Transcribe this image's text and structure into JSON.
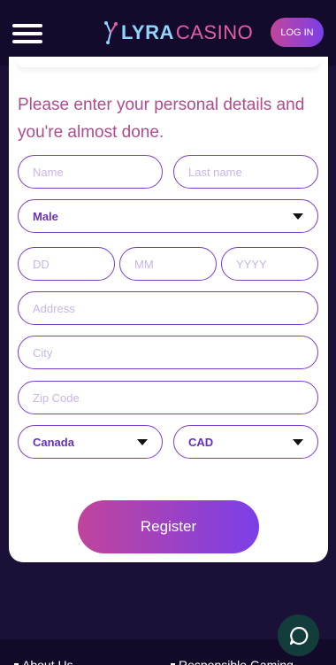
{
  "header": {
    "logo_word_1": "LYRA",
    "logo_word_2": "CASINO",
    "login_label": "LOG IN",
    "menu_icon": "hamburger-icon"
  },
  "form": {
    "heading": "Please enter your personal details and you're almost done.",
    "name_placeholder": "Name",
    "last_name_placeholder": "Last name",
    "gender_value": "Male",
    "dd_placeholder": "DD",
    "mm_placeholder": "MM",
    "yyyy_placeholder": "YYYY",
    "address_placeholder": "Address",
    "city_placeholder": "City",
    "zip_placeholder": "Zip Code",
    "country_value": "Canada",
    "currency_value": "CAD",
    "register_label": "Register"
  },
  "footer": {
    "links": [
      "About Us",
      "Responsible Gaming"
    ]
  },
  "colors": {
    "brand_gradient_start": "#c0449c",
    "brand_gradient_end": "#7b3fe8",
    "background": "#1b1038",
    "field_border": "#7a3fc8"
  },
  "icons": {
    "chat": "chat-bubble-icon",
    "caret": "caret-down-icon"
  }
}
